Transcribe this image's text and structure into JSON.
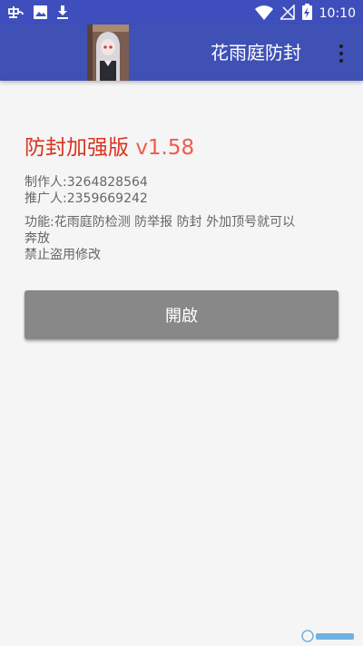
{
  "status_bar": {
    "time": "10:10",
    "left_icons": [
      "weibo-icon",
      "image-icon",
      "download-icon"
    ],
    "right_icons": [
      "wifi-icon",
      "no-signal-icon",
      "battery-charging-icon"
    ]
  },
  "app_bar": {
    "title": "花雨庭防封",
    "avatar": "anime-character-avatar",
    "menu_icon": "overflow-menu-icon"
  },
  "main": {
    "headline": "防封加强版",
    "version": "v1.58",
    "maker": "制作人:3264828564",
    "promoter": "推广人:2359669242",
    "description_line1": "功能:花雨庭防检测  防举报  防封  外加顶号就可以",
    "description_line2": "奔放",
    "description_line3": "禁止盗用修改",
    "open_button": "開啟"
  },
  "colors": {
    "primary": "#3f51b5",
    "status_bar": "#3e4fbd",
    "headline": "#d9331f",
    "version": "#ef5b4a",
    "button": "#888888",
    "background": "#f5f5f5"
  }
}
